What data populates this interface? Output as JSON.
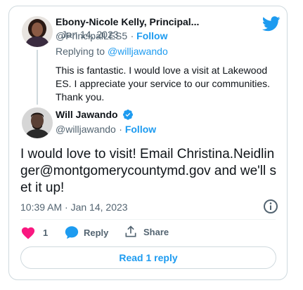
{
  "reply_tweet": {
    "display_name": "Ebony-Nicole Kelly, Principal...",
    "date": "· Jan 14, 2023",
    "handle": "@PrincipalLES5",
    "follow_label": "Follow",
    "replying_prefix": "Replying to ",
    "replying_handle": "@willjawando",
    "text": "This is fantastic. I would love a visit at Lakewood ES. I appreciate your service to our communities. Thank you."
  },
  "main_tweet": {
    "display_name": "Will Jawando",
    "handle": "@willjawando",
    "follow_label": "Follow",
    "text": "I would love to visit! Email Christina.Neidlinger@montgomerycountymd.gov and we'll set it up!",
    "timestamp": "10:39 AM · Jan 14, 2023"
  },
  "actions": {
    "like_count": "1",
    "reply_label": "Reply",
    "share_label": "Share"
  },
  "read_replies_label": "Read 1 reply",
  "colors": {
    "accent": "#1d9bf0",
    "like": "#f91880",
    "verified": "#1d9bf0"
  },
  "icons": [
    "twitter-bird-icon",
    "verified-badge-icon",
    "info-icon",
    "heart-icon",
    "reply-bubble-icon",
    "share-icon"
  ]
}
